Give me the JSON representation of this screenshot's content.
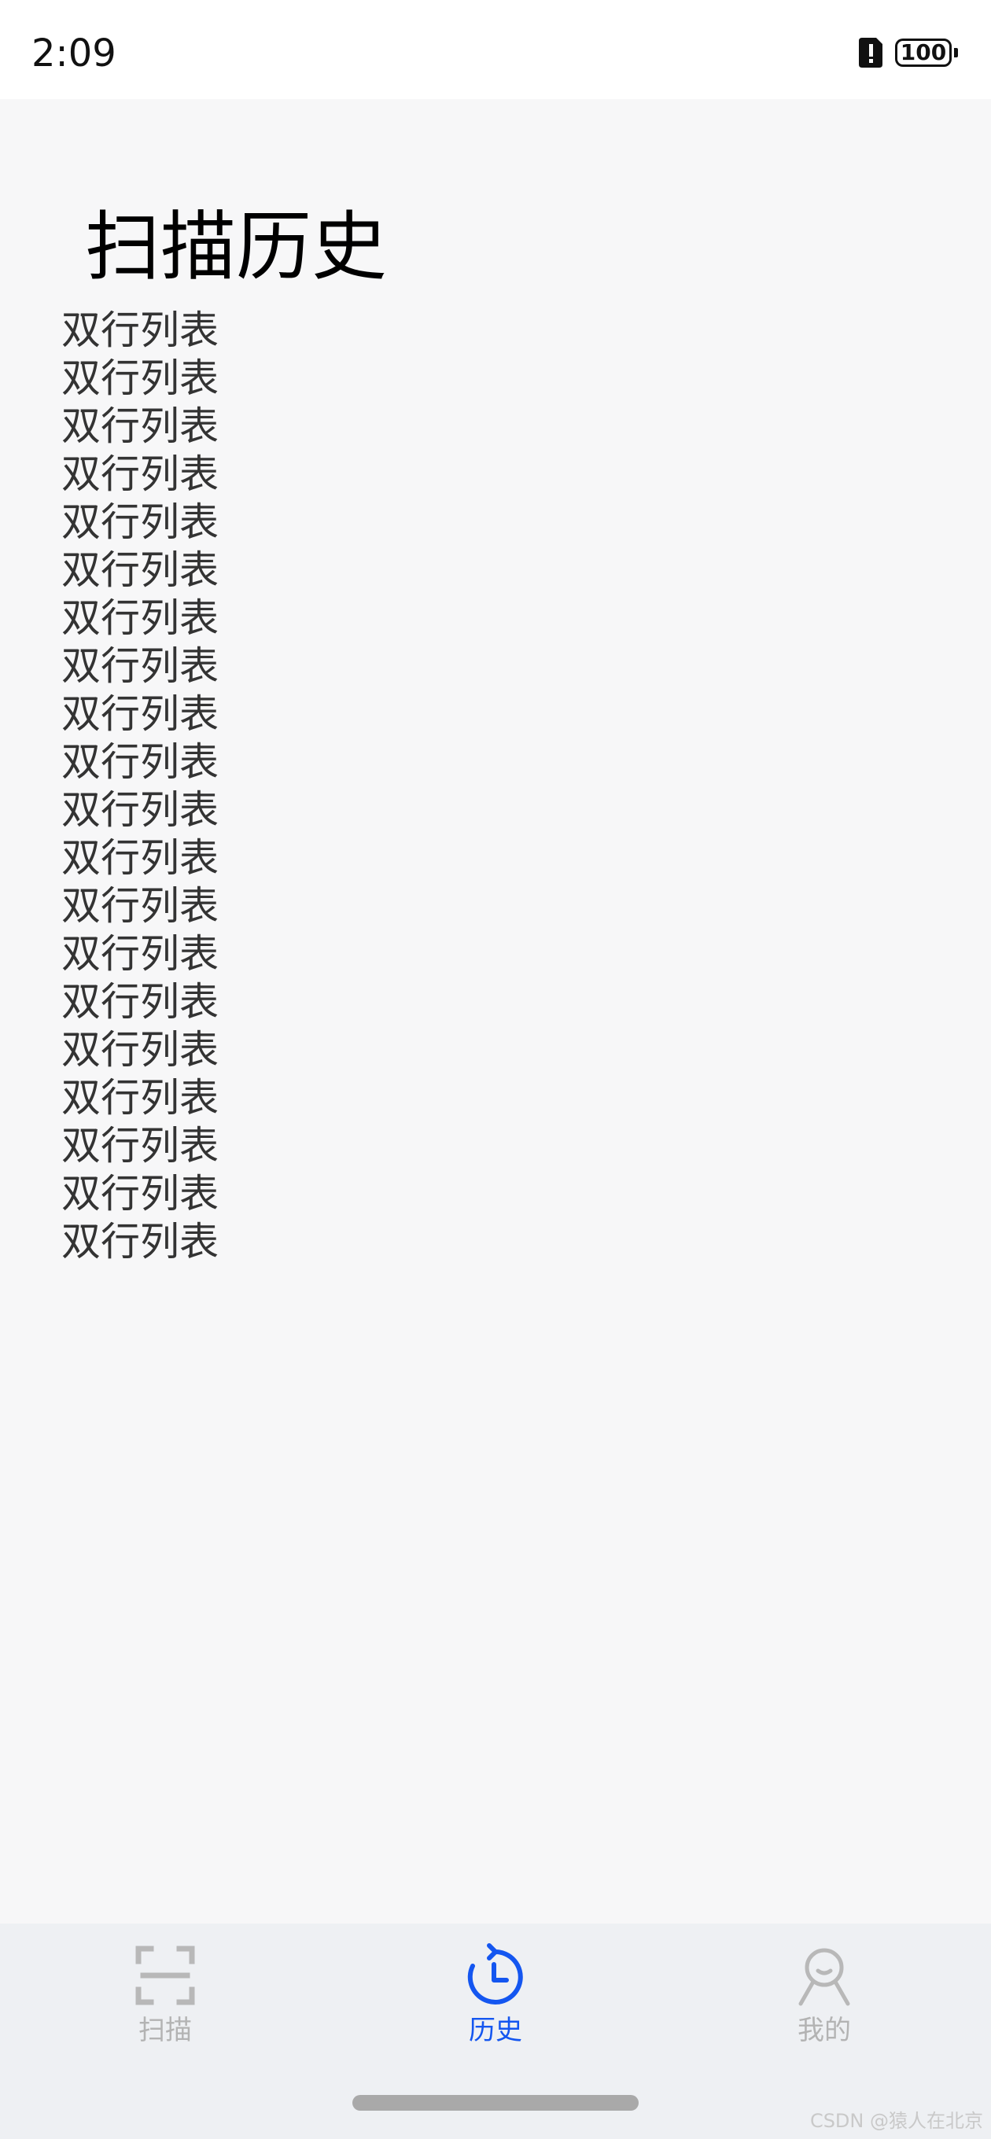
{
  "status_bar": {
    "time": "2:09",
    "battery": "100",
    "icons": [
      "sim-alert-icon",
      "battery-icon"
    ]
  },
  "page": {
    "title": "扫描历史",
    "items": [
      "双行列表",
      "双行列表",
      "双行列表",
      "双行列表",
      "双行列表",
      "双行列表",
      "双行列表",
      "双行列表",
      "双行列表",
      "双行列表",
      "双行列表",
      "双行列表",
      "双行列表",
      "双行列表",
      "双行列表",
      "双行列表",
      "双行列表",
      "双行列表",
      "双行列表",
      "双行列表"
    ]
  },
  "tab_bar": {
    "tabs": [
      {
        "label": "扫描",
        "icon": "scan-icon",
        "active": false
      },
      {
        "label": "历史",
        "icon": "history-icon",
        "active": true
      },
      {
        "label": "我的",
        "icon": "profile-icon",
        "active": false
      }
    ],
    "active_color": "#1456f0",
    "inactive_color": "#b3b3b3"
  },
  "watermark": "CSDN @猿人在北京"
}
